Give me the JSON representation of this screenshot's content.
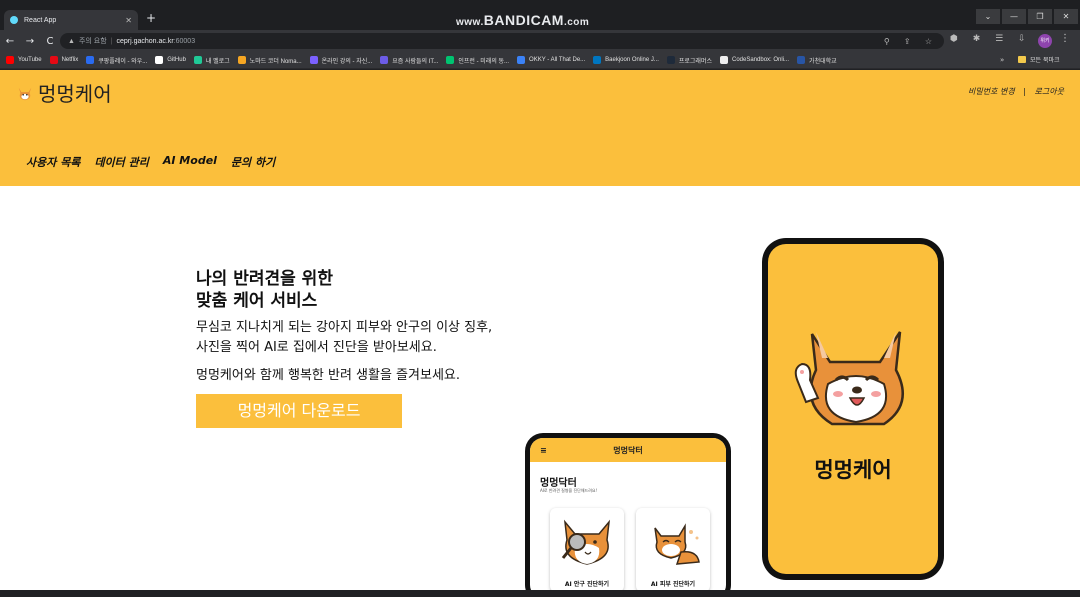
{
  "browser": {
    "tab_title": "React App",
    "tab_close": "✕",
    "new_tab": "+",
    "watermark_prefix": "www.",
    "watermark_brand": "BANDICAM",
    "watermark_suffix": ".com",
    "window_controls": [
      "⌄",
      "—",
      "❐",
      "✕"
    ],
    "nav": {
      "back": "←",
      "forward": "→",
      "reload": "C"
    },
    "address": {
      "warning_icon": "▲",
      "security_label": "주의 요함",
      "host": "ceprj.gachon.ac.kr",
      "port": ":60003"
    },
    "address_right_icons": "⚲ ⇪ ☆",
    "extension_icons": "⬢ ✱ ☰ ⇩",
    "profile_initials": "위키",
    "menu_dots": "⋮",
    "bookmarks": [
      {
        "label": "YouTube",
        "color": "#ff0000"
      },
      {
        "label": "Netflix",
        "color": "#e50914"
      },
      {
        "label": "쿠팡플레이 - 와우...",
        "color": "#2a6bf0"
      },
      {
        "label": "GitHub",
        "color": "#ffffff"
      },
      {
        "label": "내 벨로그",
        "color": "#20c997"
      },
      {
        "label": "노마드 코더 Noma...",
        "color": "#f5a623"
      },
      {
        "label": "온라인 강의 - 자신...",
        "color": "#7b61ff"
      },
      {
        "label": "요즘 사람들의 IT...",
        "color": "#6c5ce7"
      },
      {
        "label": "인프런 - 미래의 동...",
        "color": "#00c471"
      },
      {
        "label": "OKKY - All That De...",
        "color": "#3b82f6"
      },
      {
        "label": "Baekjoon Online J...",
        "color": "#0076c0"
      },
      {
        "label": "프로그래머스",
        "color": "#1e2a3a"
      },
      {
        "label": "CodeSandbox: Onli...",
        "color": "#eeeeee"
      },
      {
        "label": "가천대학교",
        "color": "#2855a5"
      }
    ],
    "bookmarks_more": "»",
    "all_bookmarks": "모든 북마크"
  },
  "page": {
    "logo_text": "멍멍케어",
    "auth_links": [
      "비밀번호 변경",
      "로그아웃"
    ],
    "nav": [
      "사용자 목록",
      "데이터 관리",
      "AI Model",
      "문의 하기"
    ],
    "hero": {
      "title_line1": "나의 반려견을 위한",
      "title_line2": "맞춤 케어 서비스",
      "desc_line1": "무심코 지나치게 되는 강아지 피부와 안구의 이상 징후,",
      "desc_line2": "사진을 찍어 AI로 집에서 진단을 받아보세요.",
      "desc_line3": "멍멍케어와 함께 행복한 반려 생활을 즐겨보세요.",
      "download_label": "멍멍케어 다운로드"
    },
    "big_phone": {
      "title": "멍멍케어"
    },
    "small_phone": {
      "header": "멍멍닥터",
      "title": "멍멍닥터",
      "subtitle": "AI로 반려견 질병을 진단해드려요!",
      "card_eye_label": "AI 안구 진단하기",
      "card_skin_label": "AI 피부 진단하기"
    },
    "colors": {
      "brand_yellow": "#fbbf3c",
      "button_text": "#ffffff"
    }
  }
}
